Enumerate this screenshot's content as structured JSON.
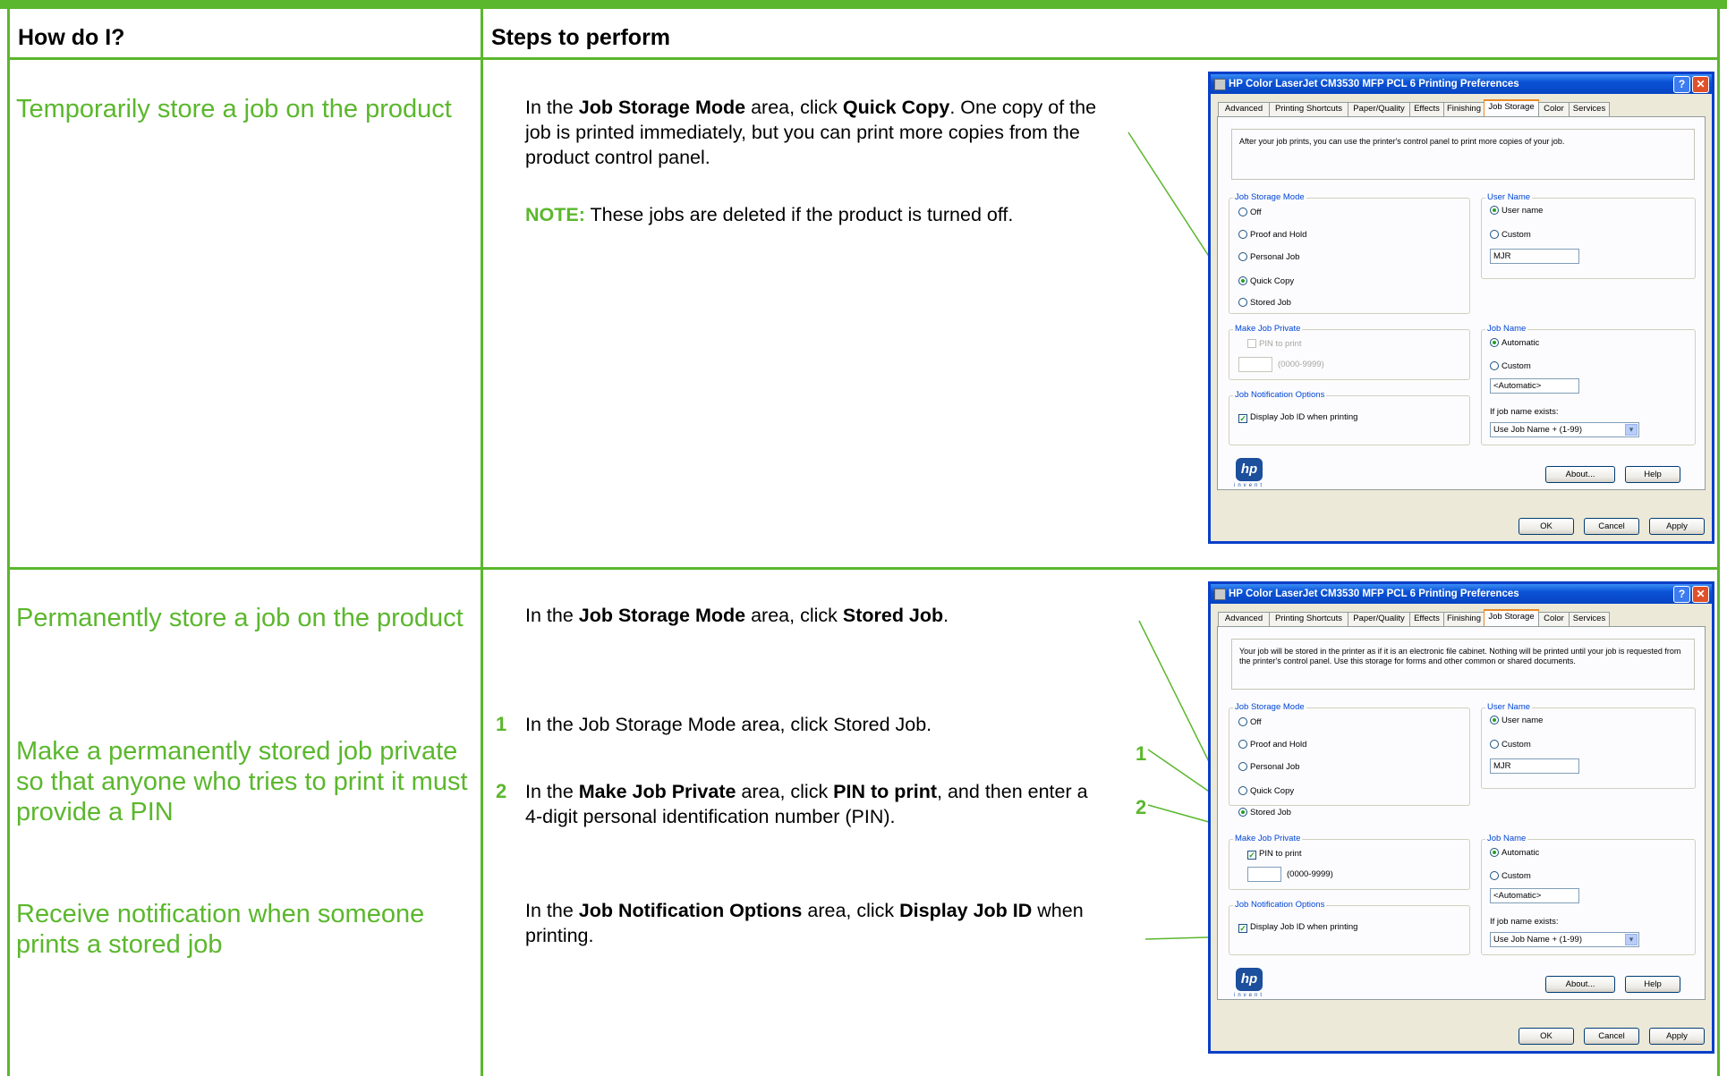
{
  "table": {
    "col1_header": "How do I?",
    "col2_header": "Steps to perform"
  },
  "rows": [
    {
      "task": "Temporarily store a job on the product",
      "step_parts": [
        "In the ",
        "Job Storage Mode",
        " area, click ",
        "Quick Copy",
        ". One copy of the job is printed immediately, but you can print more copies from the product control panel."
      ],
      "note_label": "NOTE:",
      "note_text": " These jobs are deleted if the product is turned off."
    },
    {
      "task": "Permanently store a job on the product",
      "step_parts": [
        "In the ",
        "Job Storage Mode",
        " area, click ",
        "Stored Job",
        "."
      ]
    },
    {
      "task": "Make a permanently stored job private so that anyone who tries to print it must provide a PIN",
      "steps": [
        {
          "num": "1",
          "text": "In the Job Storage Mode area, click Stored Job."
        },
        {
          "num": "2",
          "parts": [
            "In the ",
            "Make Job Private",
            " area, click ",
            "PIN to print",
            ", and then enter a 4-digit personal identification number (PIN)."
          ]
        }
      ]
    },
    {
      "task": "Receive notification when someone prints a stored job",
      "step_parts": [
        "In the ",
        "Job Notification Options",
        " area, click ",
        "Display Job ID",
        " when printing."
      ]
    }
  ],
  "callouts": [
    "1",
    "2"
  ],
  "dialog_common": {
    "title": "HP Color LaserJet CM3530 MFP PCL 6 Printing Preferences",
    "help_glyph": "?",
    "close_glyph": "✕",
    "tabs": [
      "Advanced",
      "Printing Shortcuts",
      "Paper/Quality",
      "Effects",
      "Finishing",
      "Job Storage",
      "Color",
      "Services"
    ],
    "active_tab": "Job Storage",
    "job_storage_mode_label": "Job Storage Mode",
    "mode_options": [
      "Off",
      "Proof and Hold",
      "Personal Job",
      "Quick Copy",
      "Stored Job"
    ],
    "user_name_label": "User Name",
    "user_name_option": "User name",
    "custom_label": "Custom",
    "user_name_value": "MJR",
    "make_private_label": "Make Job Private",
    "pin_label": "PIN to print",
    "pin_range": "(0000-9999)",
    "job_name_label": "Job Name",
    "automatic_label": "Automatic",
    "job_name_value": "<Automatic>",
    "notify_label": "Job Notification Options",
    "display_id_label": "Display Job ID when printing",
    "if_exists_label": "If job name exists:",
    "if_exists_value": "Use Job Name + (1-99)",
    "about_label": "About...",
    "help_label": "Help",
    "ok_label": "OK",
    "cancel_label": "Cancel",
    "apply_label": "Apply",
    "logo_text": "hp",
    "logo_sub": "invent"
  },
  "dialogs": [
    {
      "description": "After your job prints, you can use the printer's control panel to print more copies of your job.",
      "selected_mode": "Quick Copy",
      "pin_checked": false
    },
    {
      "description": "Your job will be stored in the printer as if it is an electronic file cabinet. Nothing will be printed until your job is requested from the printer's control panel. Use this storage for forms and other common or shared documents.",
      "selected_mode": "Stored Job",
      "pin_checked": true
    }
  ],
  "colors": {
    "accent": "#5bb72d",
    "titlebar": "#0a52d6",
    "dialog_bg": "#ece9d8"
  }
}
